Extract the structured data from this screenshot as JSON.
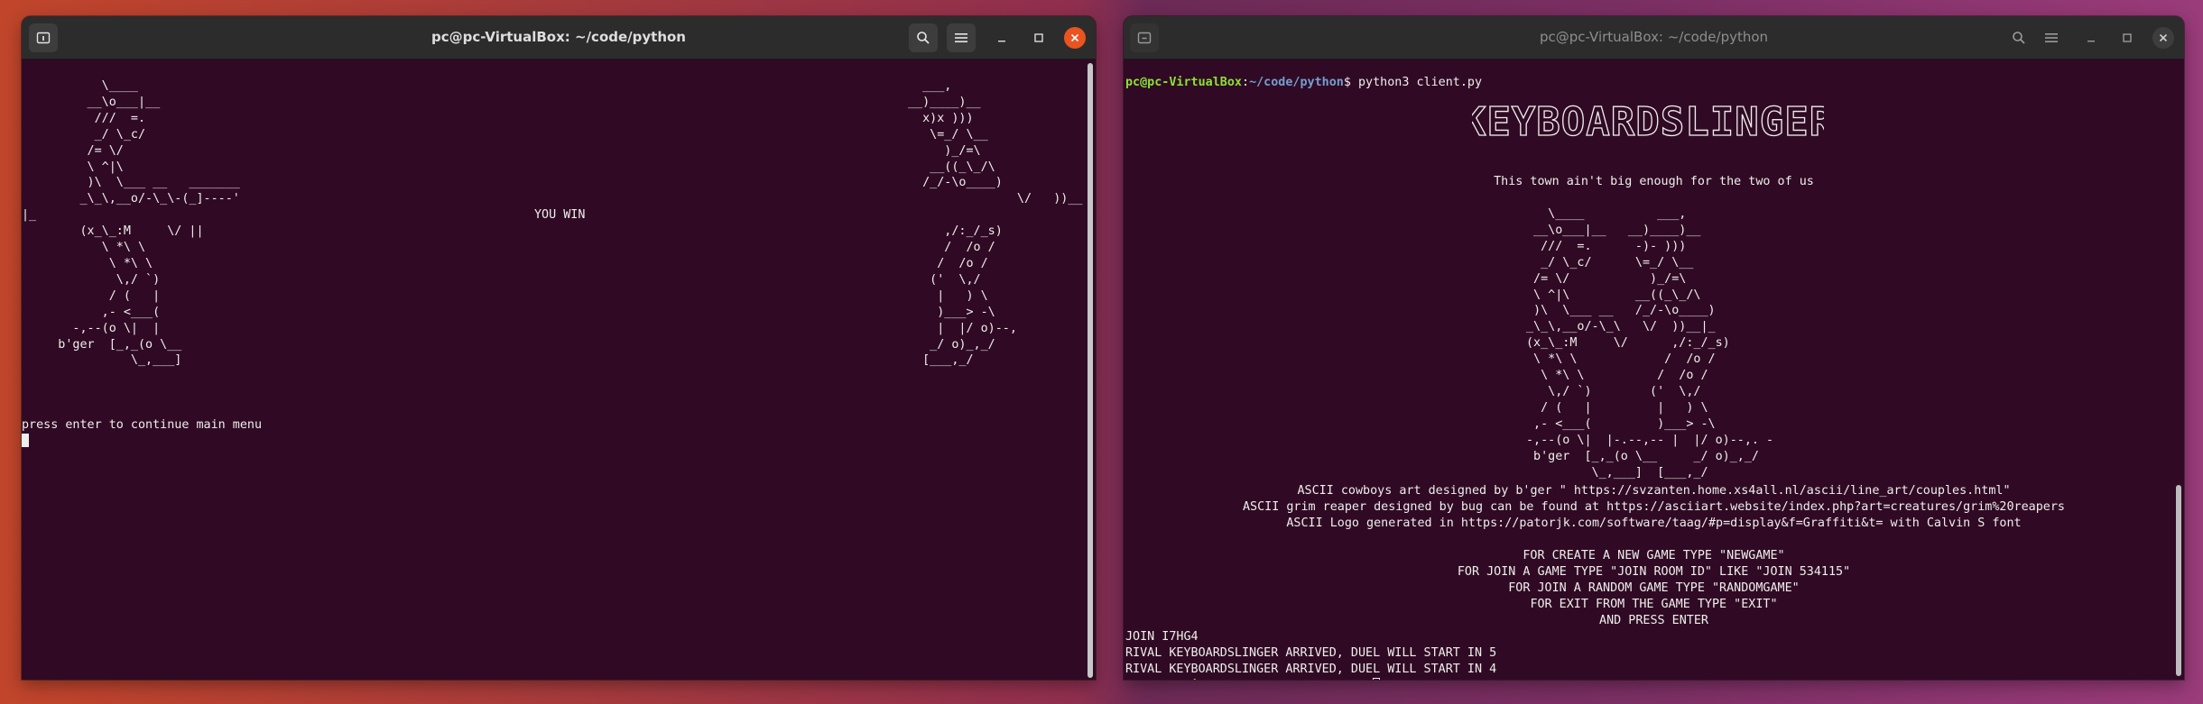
{
  "window_left": {
    "title": "pc@pc-VirtualBox: ~/code/python",
    "icons": {
      "new_tab": "terminal-tab-icon",
      "search": "search-icon",
      "menu": "hamburger-menu-icon",
      "minimize": "minimize-icon",
      "maximize": "maximize-icon",
      "close": "close-icon"
    },
    "art": "           \\____\n         __\\o___|__\n          ///  =.\n          _/ \\_c/\n         /= \\/\n         \\ ^|\\\n         )\\  \\___ __   _______\n        _\\_\\,__o/-\\_\\-(_]----'\n|_\n        (x_\\_:M     \\/ ||\n           \\ *\\ \\\n            \\ *\\ \\\n             \\,/ `)\n            / (   |\n           ,- <___(\n       -,--(o \\|  |\n     b'ger  [_,_(o \\__\n               \\_,___]",
    "art_right": "  ___,\n__)____)__\n  x)x )))\n   \\=_/ \\__\n     )_/=\\\n   __((_\\_/\\\n  /_/-\\o____)\n               \\/   ))__\n\n     ,/:_/_s)\n     /  /o /\n    /  /o /\n   ('  \\,/\n    |   ) \\\n    )___> -\\\n    |  |/ o)--,\n   _/ o)_,_/\n  [___,_/",
    "you_win": "YOU WIN",
    "prompt_line": "press enter to continue main menu"
  },
  "window_right": {
    "title": "pc@pc-VirtualBox: ~/code/python",
    "icons": {
      "new_tab": "terminal-tab-icon",
      "search": "search-icon",
      "menu": "hamburger-menu-icon",
      "minimize": "minimize-icon",
      "maximize": "maximize-icon",
      "close": "close-icon"
    },
    "prompt": {
      "user": "pc@pc-VirtualBox",
      "path": "~/code/python",
      "symbol": "$",
      "command": " python3 client.py"
    },
    "logo": "KEYBOARDSLINGER",
    "tagline": "This town ain't big enough for the two of us",
    "art": "   \\____          ___,\n __\\o___|__   __)____)__\n  ///  =.      -)- )))\n  _/ \\_c/      \\=_/ \\__\n /= \\/           )_/=\\\n \\ ^|\\         __((_\\_/\\\n )\\  \\___ __   /_/-\\o____)\n_\\_\\,__o/-\\_\\   \\/  ))__|_\n(x_\\_:M     \\/      ,/:_/_s)\n \\ *\\ \\            /  /o /\n  \\ *\\ \\          /  /o /\n   \\,/ `)        ('  \\,/\n  / (   |         |   ) \\\n ,- <___(         )___> -\\\n-,--(o \\|  |-.--,-- |  |/ o)--,. -\n b'ger  [_,_(o \\__     _/ o)_,_/\n         \\_,___]  [___,_/",
    "credits": [
      "ASCII cowboys art designed by b'ger \" https://svzanten.home.xs4all.nl/ascii/line_art/couples.html\"",
      "ASCII grim reaper designed by bug can be found at https://asciiart.website/index.php?art=creatures/grim%20reapers",
      "ASCII Logo generated in https://patorjk.com/software/taag/#p=display&f=Graffiti&t= with Calvin S font"
    ],
    "menu": [
      "FOR CREATE A NEW GAME TYPE \"NEWGAME\"",
      "FOR JOIN A GAME TYPE \"JOIN ROOM ID\" LIKE \"JOIN 534115\"",
      "FOR JOIN A RANDOM GAME TYPE \"RANDOMGAME\"",
      "FOR EXIT FROM THE GAME TYPE \"EXIT\"",
      "AND PRESS ENTER"
    ],
    "output": [
      "JOIN I7HG4",
      "RIVAL KEYBOARDSLINGER ARRIVED, DUEL WILL START IN 5",
      "RIVAL KEYBOARDSLINGER ARRIVED, DUEL WILL START IN 4"
    ],
    "last_prompt_prefix": "^Z"
  }
}
